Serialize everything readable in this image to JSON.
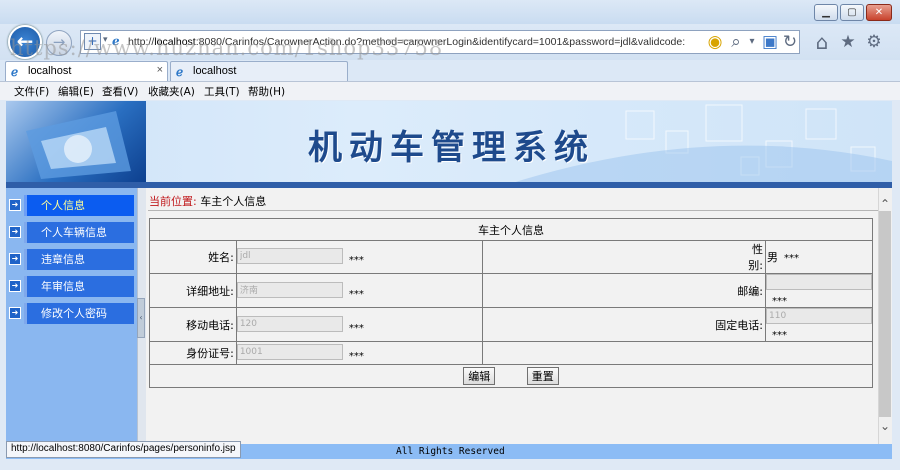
{
  "browser": {
    "address_prefix": "http://",
    "address_host": "localhost",
    "address_rest": ":8080/Carinfos/CarownerAction.do?method=carownerLogin&identifycard=1001&password=jdl&validcode:",
    "watermark": "https://www.huzhan.com/1shop33758",
    "tabs": [
      {
        "label": "localhost"
      },
      {
        "label": "localhost"
      }
    ],
    "tab_close": "×",
    "menu": [
      {
        "label": "文件(F)"
      },
      {
        "label": "编辑(E)"
      },
      {
        "label": "查看(V)"
      },
      {
        "label": "收藏夹(A)"
      },
      {
        "label": "工具(T)"
      },
      {
        "label": "帮助(H)"
      }
    ],
    "status_url": "http://localhost:8080/Carinfos/pages/personinfo.jsp"
  },
  "banner": {
    "title": "机动车管理系统"
  },
  "sidebar": {
    "items": [
      {
        "label": "个人信息",
        "active": true
      },
      {
        "label": "个人车辆信息"
      },
      {
        "label": "违章信息"
      },
      {
        "label": "年审信息"
      },
      {
        "label": "修改个人密码"
      }
    ]
  },
  "breadcrumb": {
    "label": "当前位置:",
    "value": "车主个人信息"
  },
  "form": {
    "title": "车主个人信息",
    "name_label": "姓名:",
    "name_value": "jdl",
    "gender_label": "性别:",
    "gender_value": "男",
    "address_label": "详细地址:",
    "address_value": "济南",
    "zip_label": "邮编:",
    "zip_value": "",
    "mobile_label": "移动电话:",
    "mobile_value": "120",
    "phone_label": "固定电话:",
    "phone_value": "110",
    "id_label": "身份证号:",
    "id_value": "1001",
    "required_mark": "***",
    "edit_button": "编辑",
    "reset_button": "重置"
  },
  "footer": {
    "text": "All Rights Reserved"
  }
}
